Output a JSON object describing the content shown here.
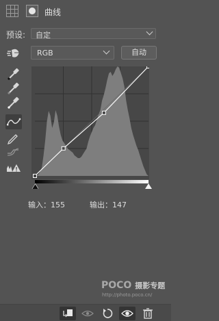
{
  "header": {
    "title": "曲线",
    "icons": [
      "curves-grid-icon",
      "layer-mask-icon"
    ]
  },
  "preset": {
    "label": "预设:",
    "value": "自定"
  },
  "channel": {
    "value": "RGB"
  },
  "auto_button": {
    "label": "自动"
  },
  "tools": [
    "targeted-adjustment-icon",
    "black-point-eyedropper-icon",
    "gray-point-eyedropper-icon",
    "white-point-eyedropper-icon",
    "curve-point-tool-icon",
    "pencil-icon",
    "smooth-curve-icon",
    "clipping-warning-icon"
  ],
  "curve": {
    "input": 155,
    "output": 147,
    "points": [
      [
        0,
        0
      ],
      [
        64,
        64
      ],
      [
        155,
        147
      ],
      [
        255,
        255
      ]
    ]
  },
  "readouts": {
    "input_text": "输入：155",
    "output_text": "输出：147"
  },
  "watermark": {
    "brand": "POCO",
    "tagline": "摄影专题",
    "url": "http://photo.poco.cn/"
  },
  "footer": [
    "clip-to-layer-icon",
    "view-previous-state-icon",
    "reset-icon",
    "visibility-eye-icon",
    "delete-icon"
  ],
  "colors": {
    "panel": "#535353",
    "graph_bg": "#474747",
    "histogram": "#7e7e7e",
    "curve": "#ffffff"
  }
}
